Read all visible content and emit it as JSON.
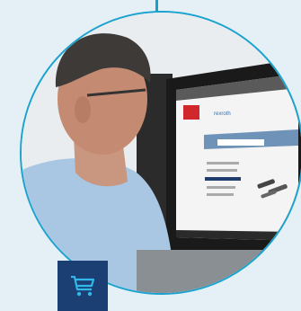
{
  "scene": {
    "accent_color": "#14a0c8",
    "badge_color": "#1b3e73",
    "badge_icon": "shopping-cart-icon",
    "screen": {
      "logo_text": "rexroth",
      "product_images": 3
    }
  }
}
